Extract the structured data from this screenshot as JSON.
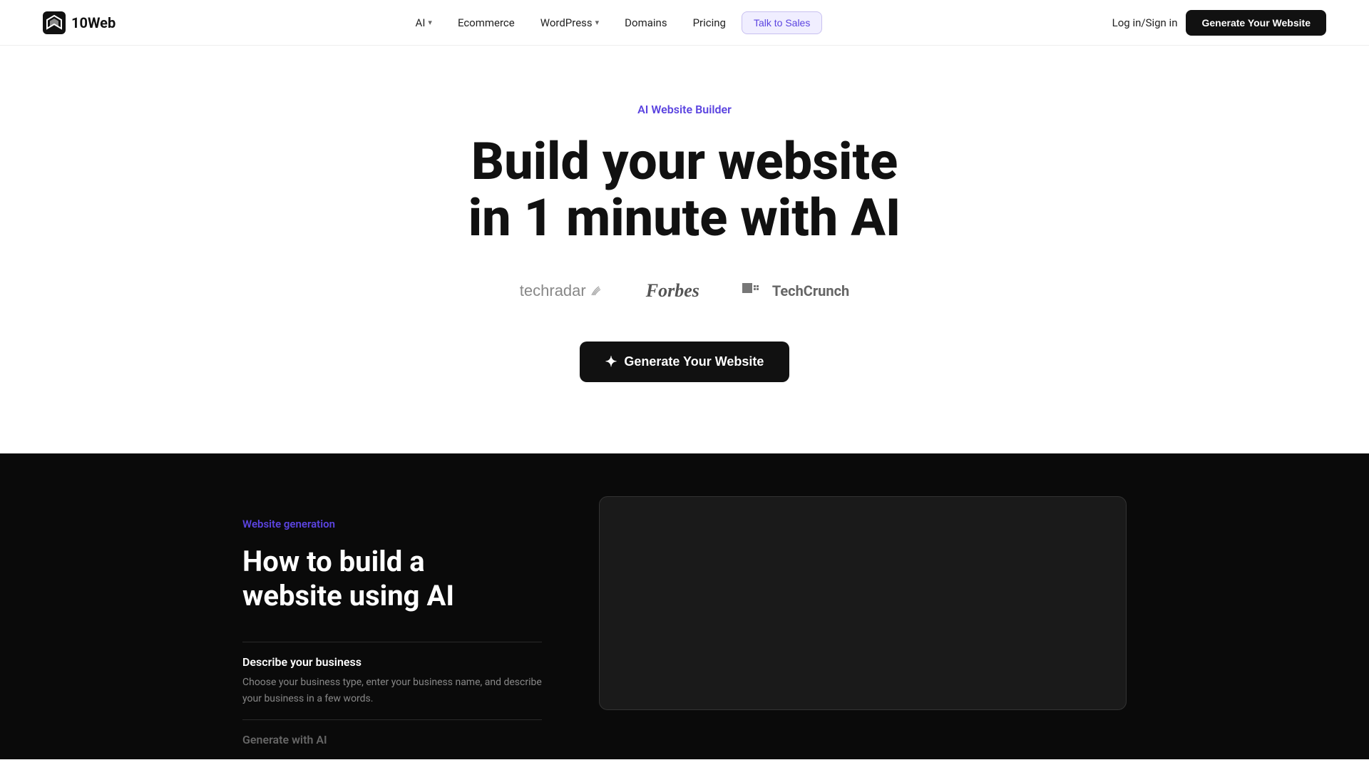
{
  "nav": {
    "logo_text": "10Web",
    "links": [
      {
        "id": "ai",
        "label": "AI",
        "has_dropdown": true
      },
      {
        "id": "ecommerce",
        "label": "Ecommerce",
        "has_dropdown": false
      },
      {
        "id": "wordpress",
        "label": "WordPress",
        "has_dropdown": true
      },
      {
        "id": "domains",
        "label": "Domains",
        "has_dropdown": false
      },
      {
        "id": "pricing",
        "label": "Pricing",
        "has_dropdown": false
      }
    ],
    "talk_to_sales_label": "Talk to Sales",
    "signin_label": "Log in/Sign in",
    "generate_btn_label": "Generate Your Website"
  },
  "hero": {
    "eyebrow": "AI Website Builder",
    "title_line1": "Build your website",
    "title_line2": "in 1 minute with AI",
    "logos": [
      {
        "id": "techradar",
        "text": "techradar"
      },
      {
        "id": "forbes",
        "text": "Forbes"
      },
      {
        "id": "techcrunch",
        "text": "TechCrunch"
      }
    ],
    "cta_label": "Generate Your Website",
    "sparkle_icon": "✦"
  },
  "website_generation": {
    "eyebrow": "Website generation",
    "title_line1": "How to build a",
    "title_line2": "website using AI",
    "steps": [
      {
        "id": "step1",
        "title": "Describe your business",
        "description": "Choose your business type, enter your business name, and describe your business in a few words.",
        "active": true
      },
      {
        "id": "step2",
        "title": "Generate with AI",
        "description": "",
        "active": false
      }
    ]
  }
}
